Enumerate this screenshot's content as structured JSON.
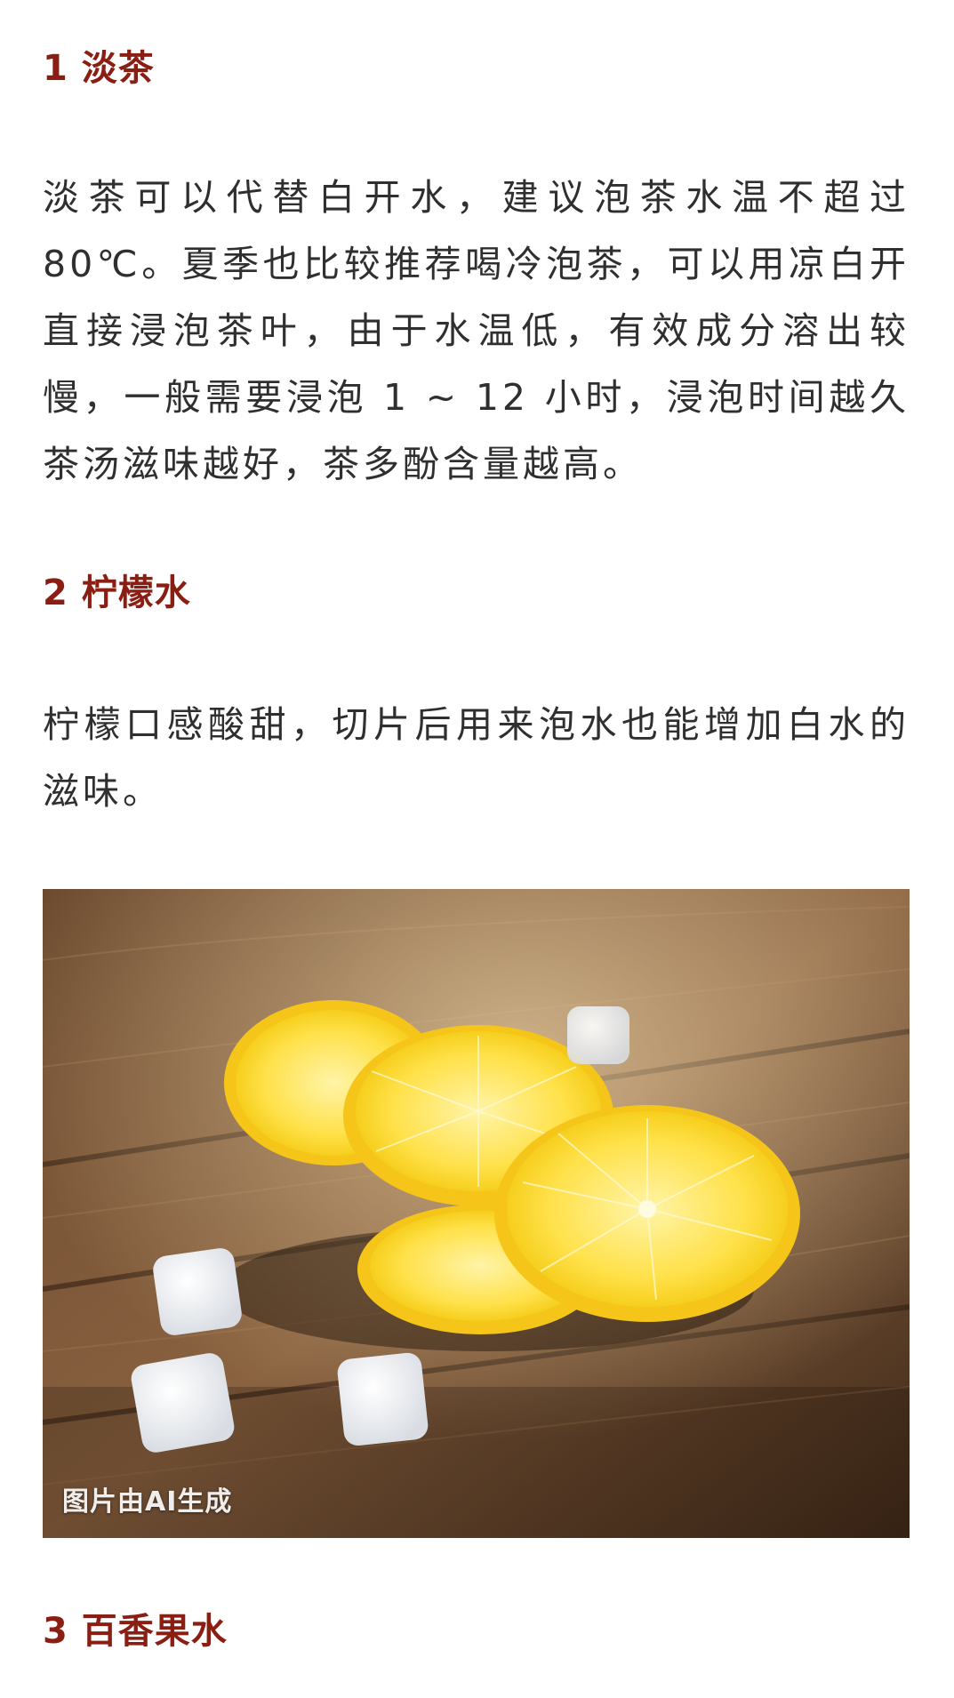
{
  "article": {
    "section1": {
      "heading": "1 淡茶",
      "paragraph": "淡茶可以代替白开水，建议泡茶水温不超过80℃。夏季也比较推荐喝冷泡茶，可以用凉白开直接浸泡茶叶，由于水温低，有效成分溶出较慢，一般需要浸泡 1 ~ 12 小时，浸泡时间越久茶汤滋味越好，茶多酚含量越高。"
    },
    "section2": {
      "heading": "2 柠檬水",
      "paragraph": "柠檬口感酸甜，切片后用来泡水也能增加白水的滋味。",
      "image_caption": "图片由AI生成"
    },
    "section3": {
      "heading": "3 百香果水"
    }
  },
  "colors": {
    "heading": "#8b1e12",
    "body_text": "#2f2f2f",
    "background": "#ffffff"
  }
}
